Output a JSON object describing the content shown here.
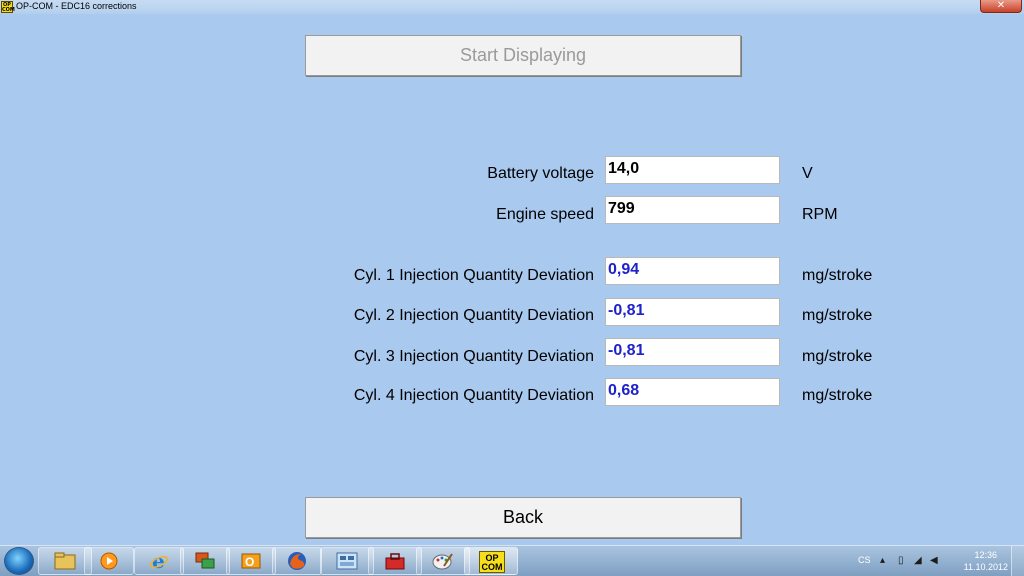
{
  "window": {
    "title": "OP-COM - EDC16 corrections",
    "icon_text": "OP COM",
    "close_glyph": "✕"
  },
  "main": {
    "start_button": "Start Displaying",
    "back_button": "Back",
    "rows": [
      {
        "label": "Battery voltage",
        "value": "14,0",
        "unit": "V",
        "value_color": "black"
      },
      {
        "label": "Engine speed",
        "value": "799",
        "unit": "RPM",
        "value_color": "black"
      },
      {
        "label": "Cyl. 1 Injection Quantity Deviation",
        "value": "0,94",
        "unit": "mg/stroke",
        "value_color": "blue"
      },
      {
        "label": "Cyl. 2 Injection Quantity Deviation",
        "value": "-0,81",
        "unit": "mg/stroke",
        "value_color": "blue"
      },
      {
        "label": "Cyl. 3 Injection Quantity Deviation",
        "value": "-0,81",
        "unit": "mg/stroke",
        "value_color": "blue"
      },
      {
        "label": "Cyl. 4 Injection Quantity Deviation",
        "value": "0,68",
        "unit": "mg/stroke",
        "value_color": "blue"
      }
    ]
  },
  "taskbar": {
    "items": [
      {
        "name": "file-explorer-icon"
      },
      {
        "name": "media-player-icon"
      },
      {
        "name": "internet-explorer-icon"
      },
      {
        "name": "remote-desktop-icon"
      },
      {
        "name": "outlook-icon"
      },
      {
        "name": "firefox-icon"
      },
      {
        "name": "control-panel-icon"
      },
      {
        "name": "toolbox-icon"
      },
      {
        "name": "paint-icon"
      },
      {
        "name": "opcom-icon",
        "label_line1": "OP",
        "label_line2": "COM"
      }
    ],
    "tray": {
      "language": "CS",
      "time": "12:36",
      "date": "11.10.2012"
    }
  },
  "colors": {
    "background": "#a9c9ef",
    "value_blue": "#1f21c9",
    "disabled_text": "#9a9a9a"
  }
}
